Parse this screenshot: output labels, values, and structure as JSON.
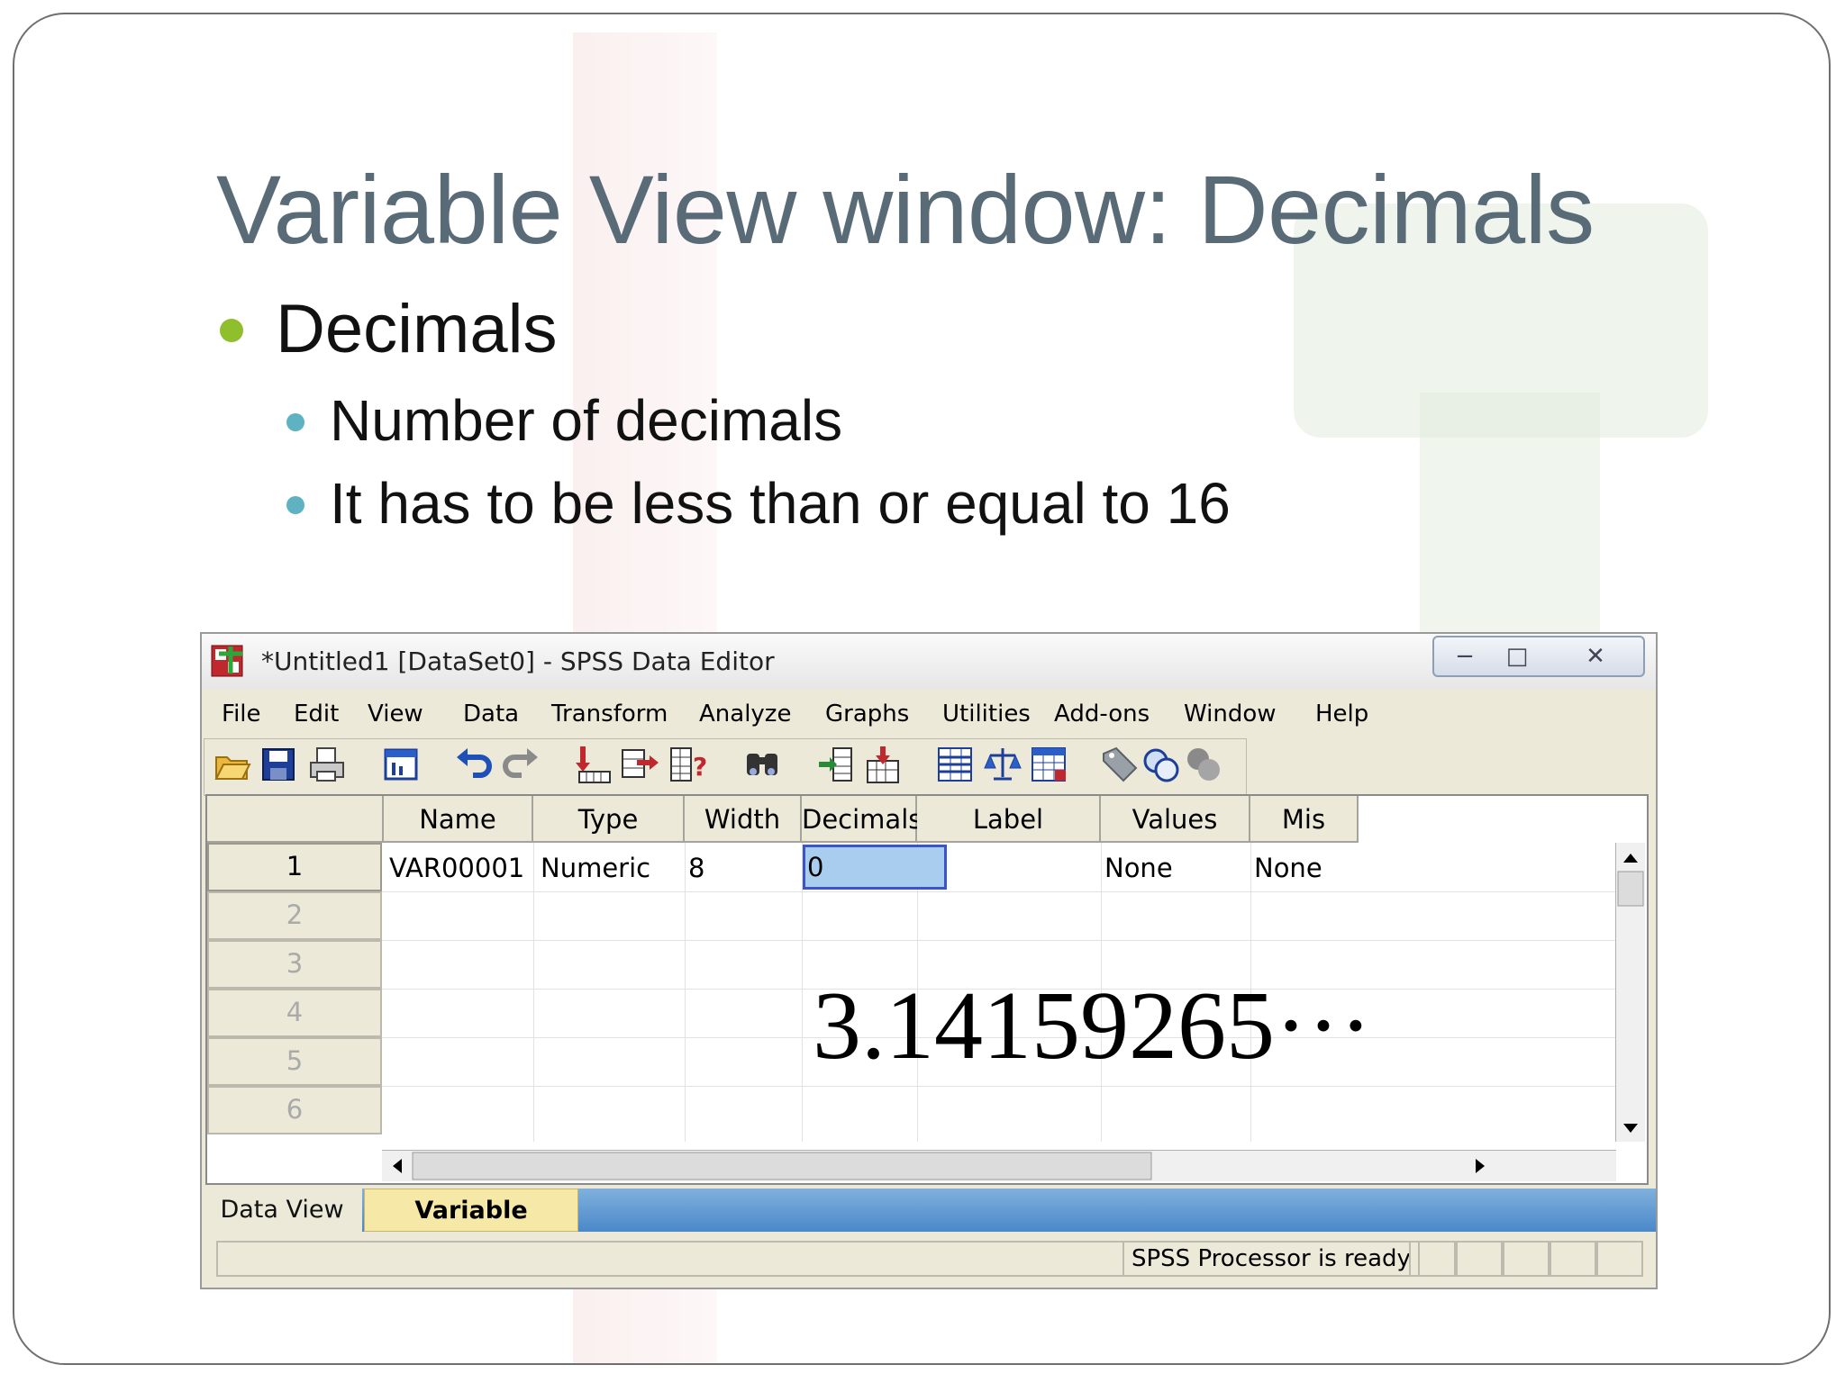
{
  "slide": {
    "title": "Variable View window: Decimals",
    "bullets": {
      "main": "Decimals",
      "sub": [
        "Number of decimals",
        "It has to be less than or equal to 16"
      ]
    },
    "overlay_text": "3.14159265···",
    "colors": {
      "title": "#5a6b78",
      "bullet_l1": "#8fbf2c",
      "bullet_l2": "#5fb2c2"
    }
  },
  "window": {
    "title": "*Untitled1 [DataSet0] - SPSS Data Editor",
    "controls": {
      "minimize": "−",
      "maximize": "□",
      "close": "✕"
    },
    "menu": [
      "File",
      "Edit",
      "View",
      "Data",
      "Transform",
      "Analyze",
      "Graphs",
      "Utilities",
      "Add-ons",
      "Window",
      "Help"
    ],
    "toolbar_icons": [
      "open-folder-icon",
      "save-icon",
      "print-icon",
      "dialog-recall-icon",
      "undo-icon",
      "redo-icon",
      "goto-case-icon",
      "goto-variable-icon",
      "variables-info-icon",
      "find-icon",
      "insert-cases-icon",
      "insert-variable-icon",
      "split-file-icon",
      "weight-cases-icon",
      "select-cases-icon",
      "value-labels-icon",
      "use-sets-icon",
      "show-all-variables-icon"
    ]
  },
  "grid": {
    "columns": [
      "Name",
      "Type",
      "Width",
      "Decimals",
      "Label",
      "Values",
      "Mis"
    ],
    "row_numbers": [
      "1",
      "2",
      "3",
      "4",
      "5",
      "6"
    ],
    "rows": [
      {
        "name": "VAR00001",
        "type": "Numeric",
        "width": "8",
        "decimals": "0",
        "label": "",
        "values": "None",
        "missing": "None"
      }
    ],
    "selected_column": "Decimals"
  },
  "tabs": {
    "data_view": "Data View",
    "variable_view": "Variable View",
    "active": "Variable View"
  },
  "status": {
    "processor": "SPSS  Processor is ready"
  }
}
